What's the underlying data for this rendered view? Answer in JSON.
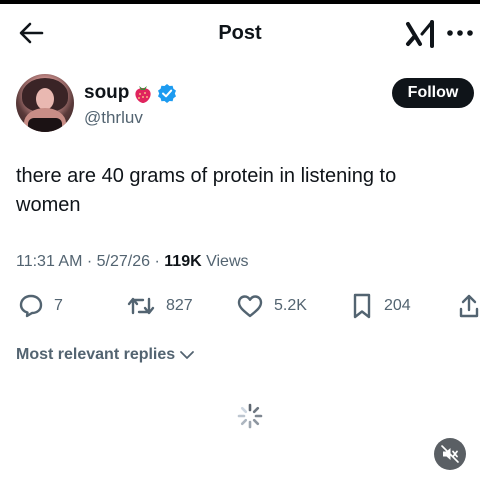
{
  "header": {
    "title": "Post",
    "back_icon": "arrow-left-icon",
    "grok_icon": "grok-icon",
    "more_icon": "more-horizontal-icon"
  },
  "author": {
    "name": "soup",
    "emoji": "🍓",
    "verified": true,
    "handle": "@thrluv",
    "follow_label": "Follow"
  },
  "post": {
    "text": "there are 40 grams of protein in listening to women",
    "time": "11:31 AM",
    "separator": "·",
    "date": "5/27/26",
    "views_count": "119K",
    "views_label": "Views"
  },
  "actions": {
    "replies": "7",
    "reposts": "827",
    "likes": "5.2K",
    "bookmarks": "204"
  },
  "replies_sort": {
    "label": "Most relevant replies"
  },
  "colors": {
    "accent": "#1d9bf0",
    "text": "#0f1419",
    "muted": "#536471",
    "strawberry": "#e0245e"
  }
}
